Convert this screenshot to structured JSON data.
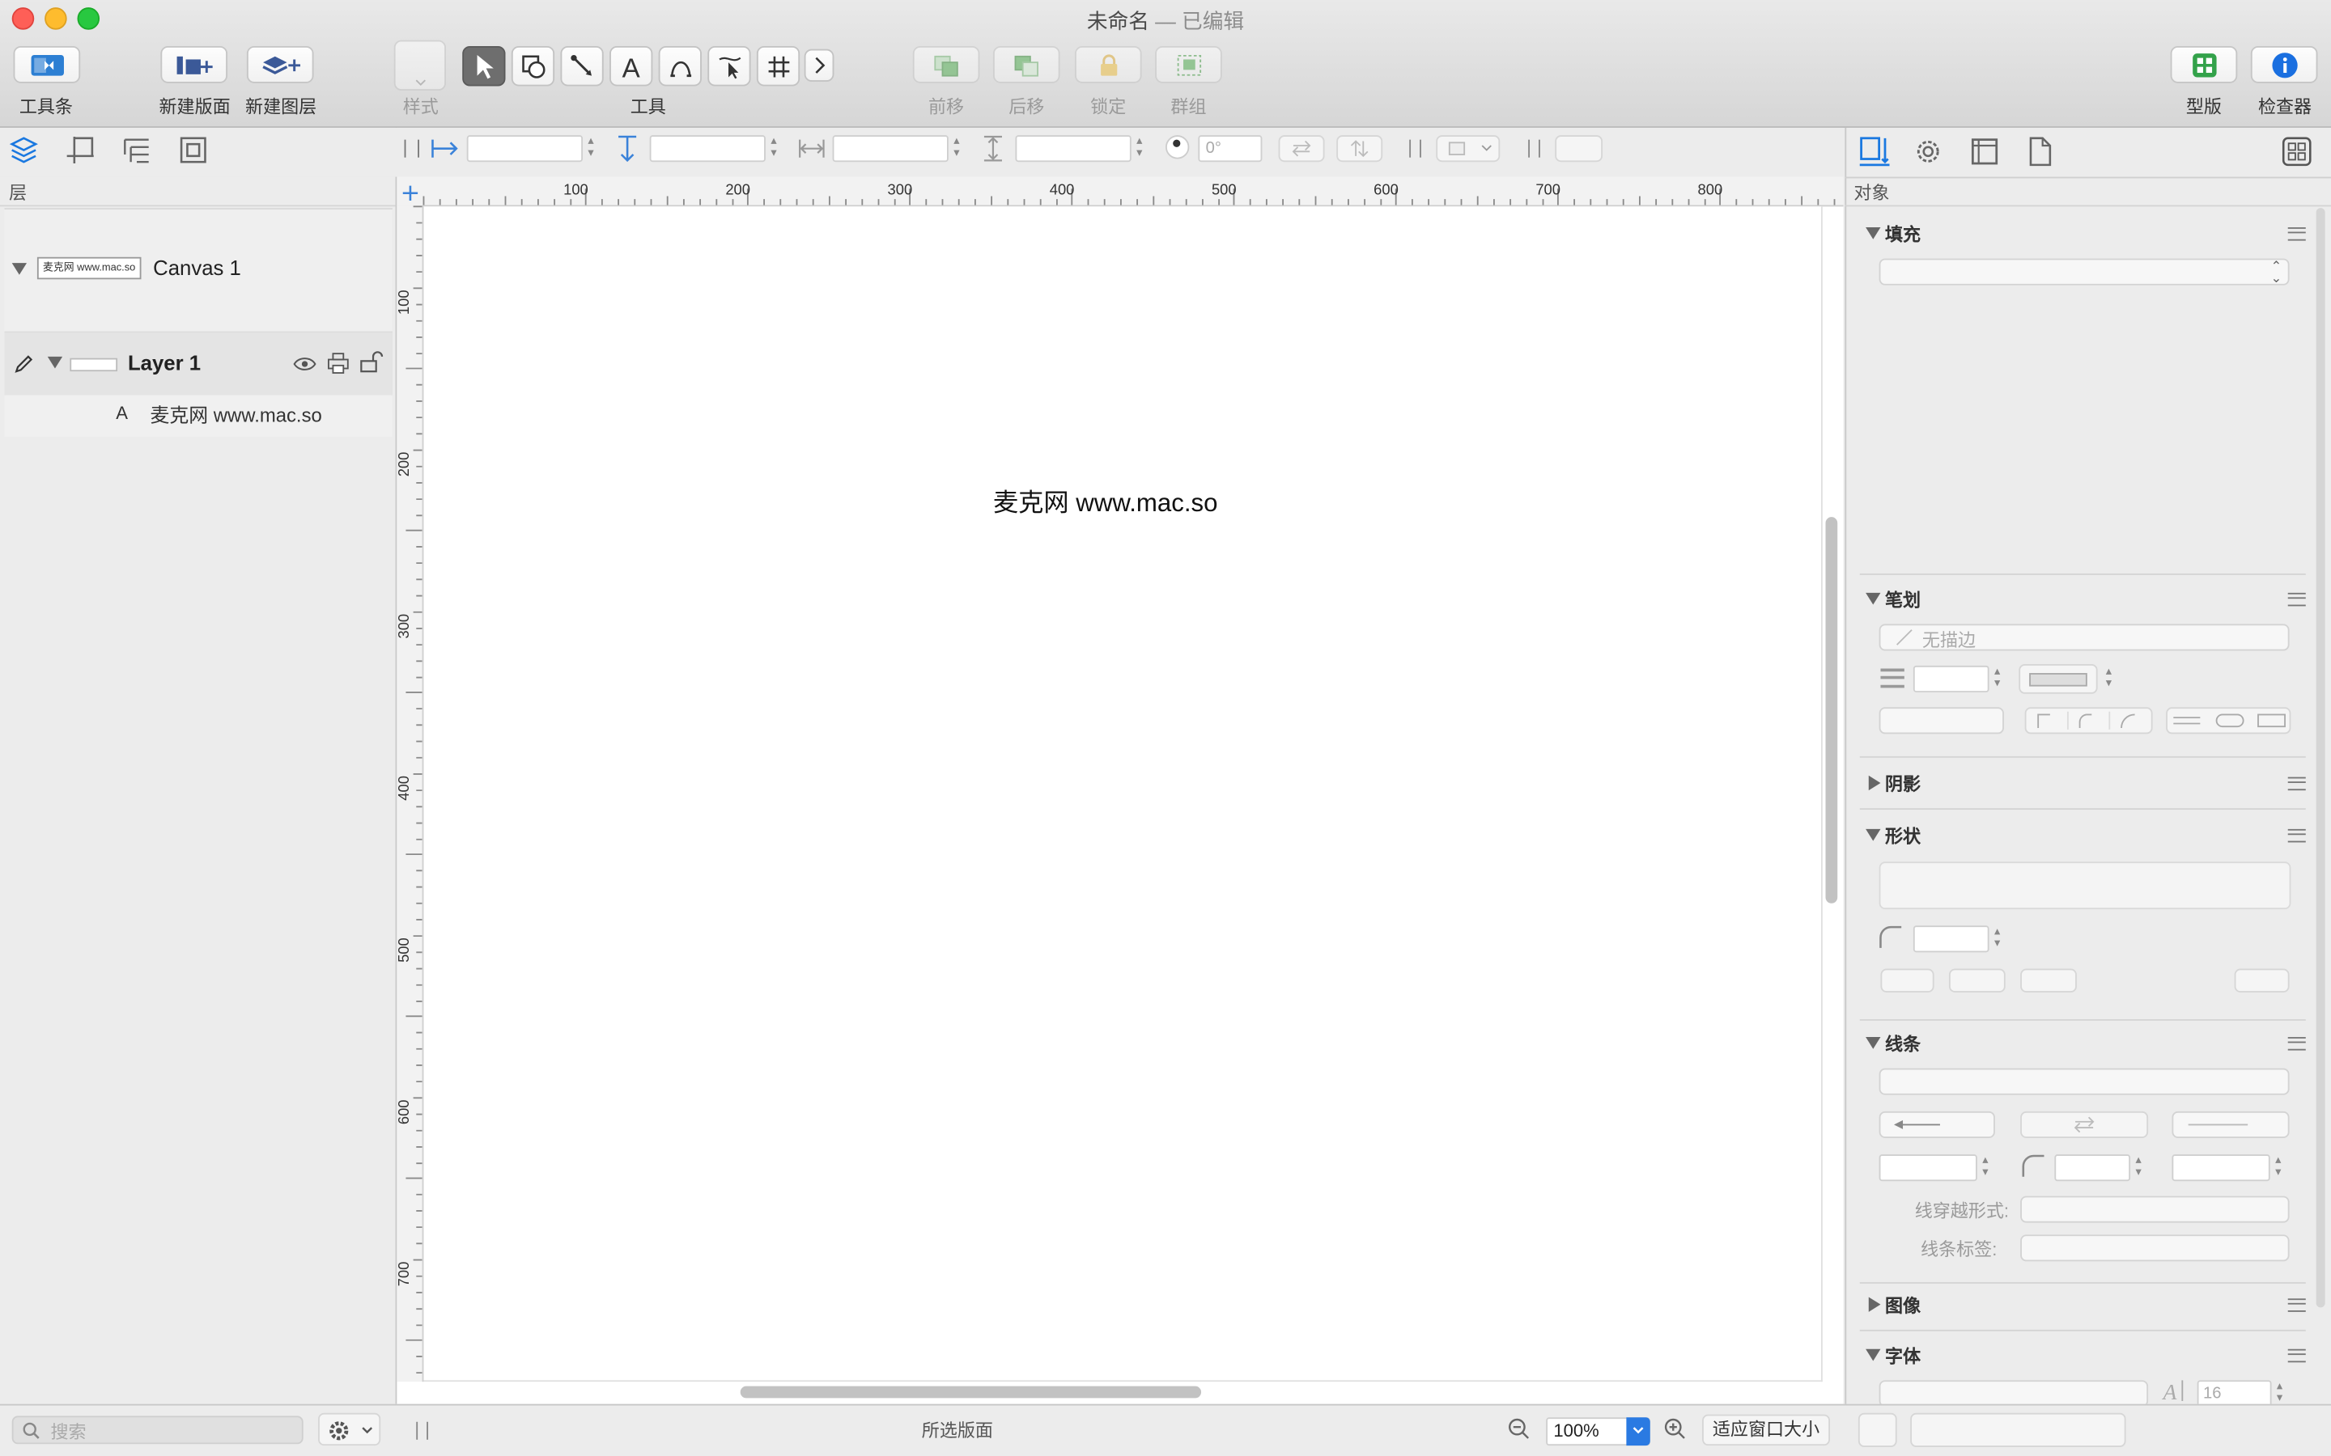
{
  "window": {
    "title": "未命名",
    "title_suffix": "— 已编辑"
  },
  "toolbar": {
    "toolbar_label": "工具条",
    "new_canvas_label": "新建版面",
    "new_layer_label": "新建图层",
    "style_label": "样式",
    "tools_label": "工具",
    "bring_forward_label": "前移",
    "send_backward_label": "后移",
    "lock_label": "锁定",
    "group_label": "群组",
    "stencils_label": "型版",
    "inspector_label": "检查器"
  },
  "format_bar": {
    "rotation": "0°"
  },
  "ruler": {
    "h_ticks": [
      "100",
      "200",
      "300",
      "400",
      "500",
      "600",
      "700",
      "800"
    ],
    "v_ticks": [
      "100",
      "200",
      "300",
      "400",
      "500",
      "600",
      "700"
    ]
  },
  "sidebar": {
    "header": "层",
    "canvas": {
      "name": "Canvas 1",
      "thumb_text": "麦克网 www.mac.so"
    },
    "layer": {
      "name": "Layer 1"
    },
    "objects": [
      {
        "type_glyph": "A",
        "name": "麦克网 www.mac.so"
      }
    ],
    "search_placeholder": "搜索"
  },
  "canvas": {
    "text_object": "麦克网 www.mac.so"
  },
  "inspector": {
    "header": "对象",
    "sections": {
      "fill": "填充",
      "stroke": "笔划",
      "stroke_none": "无描边",
      "shadow": "阴影",
      "shape": "形状",
      "lines": "线条",
      "line_cross": "线穿越形式:",
      "line_label": "线条标签:",
      "image": "图像",
      "font": "字体",
      "font_size": "16"
    }
  },
  "bottom": {
    "selected_canvas": "所选版面",
    "zoom": "100%",
    "fit_window": "适应窗口大小"
  }
}
